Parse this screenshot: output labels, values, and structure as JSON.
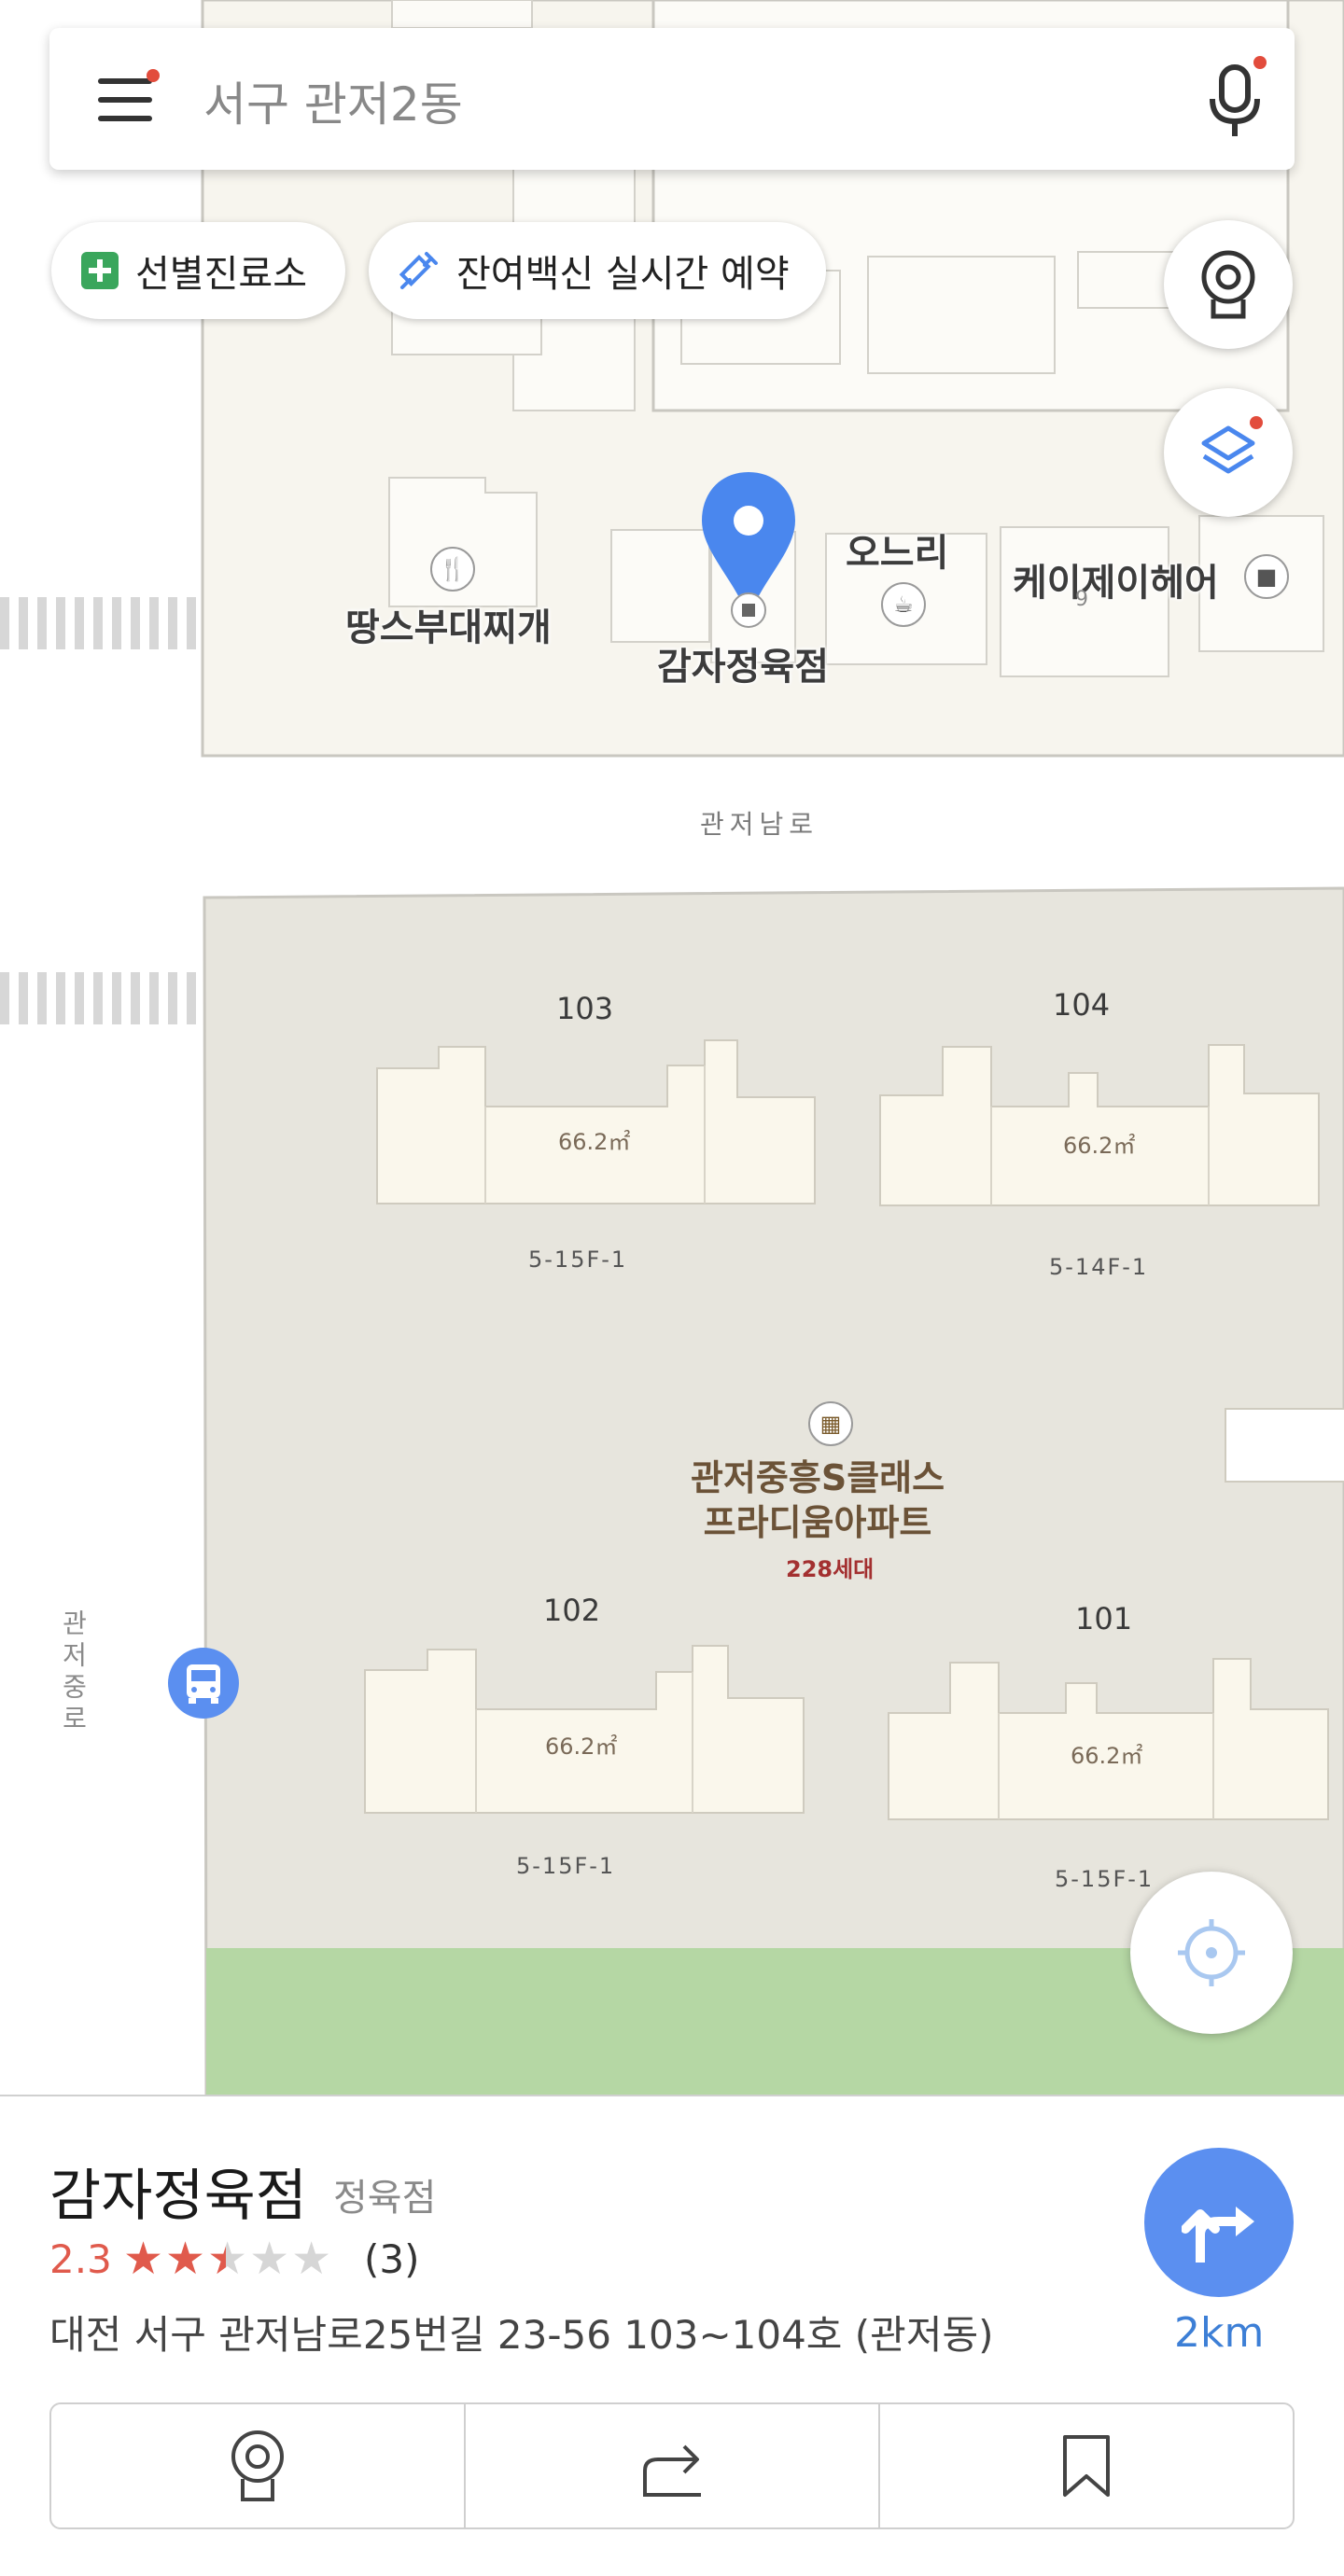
{
  "search": {
    "placeholder": "서구 관저2동",
    "menu_icon": "hamburger-menu-icon",
    "mic_icon": "microphone-icon"
  },
  "chips": [
    {
      "label": "선별진료소",
      "icon": "plus-cross-icon"
    },
    {
      "label": "잔여백신 실시간 예약",
      "icon": "syringe-icon"
    }
  ],
  "map": {
    "roads": {
      "south_road": "관저남로",
      "west_road": "관저중로"
    },
    "pois": [
      {
        "name": "땅스부대찌개",
        "icon": "restaurant-icon"
      },
      {
        "name": "감자정육점",
        "icon": "location-pin-icon",
        "selected": true
      },
      {
        "name": "오느리",
        "icon": "cafe-icon"
      },
      {
        "name": "케이제이헤어",
        "icon": "shop-icon"
      }
    ],
    "building_number_small": "9",
    "apartment": {
      "name_line1": "관저중흥S클래스",
      "name_line2": "프라디움아파트",
      "units": "228세대"
    },
    "buildings": [
      {
        "number": "103",
        "area": "66.2㎡",
        "floors": "5-15F-1"
      },
      {
        "number": "104",
        "area": "66.2㎡",
        "floors": "5-14F-1"
      },
      {
        "number": "102",
        "area": "66.2㎡",
        "floors": "5-15F-1"
      },
      {
        "number": "101",
        "area": "66.2㎡",
        "floors": "5-15F-1"
      }
    ],
    "colors": {
      "block": "#f7f5ee",
      "apartment_block": "#e7e5dd",
      "building": "#faf7ec",
      "park": "#b5d7a4",
      "pin": "#4a87ee"
    }
  },
  "place": {
    "name": "감자정육점",
    "category": "정육점",
    "rating": "2.3",
    "rating_value": 2.3,
    "rating_max": 5,
    "review_count": "(3)",
    "address": "대전 서구 관저남로25번길 23-56 103~104호 (관저동)",
    "distance": "2km",
    "route_icon": "directions-icon"
  },
  "actions": [
    {
      "name": "roadview",
      "icon": "roadview-icon"
    },
    {
      "name": "share",
      "icon": "share-icon"
    },
    {
      "name": "bookmark",
      "icon": "bookmark-icon"
    }
  ]
}
